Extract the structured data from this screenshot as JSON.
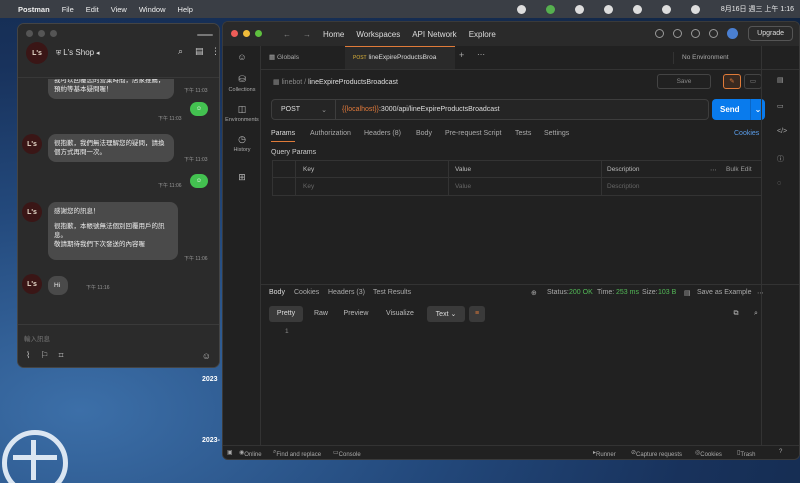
{
  "menubar": {
    "app": "Postman",
    "items": [
      "File",
      "Edit",
      "View",
      "Window",
      "Help"
    ],
    "datetime": "8月16日 週三 上午 1:16"
  },
  "desktop": {
    "stamp1": "2023",
    "stamp2": "2023-"
  },
  "line": {
    "avatar_text": "L's",
    "shop_name": "L's Shop",
    "input_placeholder": "輸入訊息",
    "messages": [
      {
        "text": "我可以回覆您的營業時間，店家推薦，預約等基本疑問喔！",
        "time": "下午 11:03"
      },
      {
        "mine": "☺",
        "time": "下午 11:03"
      },
      {
        "text": "很抱歉，我們無法理解您的疑問，請換個方式再問一次。",
        "time": "下午 11:03"
      },
      {
        "mine": "☺",
        "time": "下午 11:06"
      },
      {
        "text1": "感謝您的訊息！",
        "text2": "很抱歉，本帳號無法個別回覆用戶的訊息。",
        "text3": "敬請期待我們下次發送的內容喔",
        "time": "下午 11:06"
      },
      {
        "text": "Hi",
        "time": "下午 11:16"
      }
    ]
  },
  "postman": {
    "nav": [
      "Home",
      "Workspaces",
      "API Network",
      "Explore"
    ],
    "upgrade": "Upgrade",
    "sidebar": [
      "Collections",
      "Environments",
      "History"
    ],
    "tabs": {
      "globals": "Globals",
      "active_method": "POST",
      "active_name": "lineExpireProductsBroa"
    },
    "environment": "No Environment",
    "breadcrumb": {
      "parent": "linebot",
      "sep": "/",
      "name": "lineExpireProductsBroadcast"
    },
    "save_label": "Save",
    "request": {
      "method": "POST",
      "url_var": "{{localhost}}",
      "url_rest": ":3000/api/lineExpireProductsBroadcast",
      "send": "Send"
    },
    "req_tabs": [
      "Params",
      "Authorization",
      "Headers (8)",
      "Body",
      "Pre-request Script",
      "Tests",
      "Settings"
    ],
    "cookies": "Cookies",
    "query_params": "Query Params",
    "table": {
      "headers": [
        "Key",
        "Value",
        "Description"
      ],
      "bulk": "Bulk Edit",
      "placeholders": [
        "Key",
        "Value",
        "Description"
      ]
    },
    "response": {
      "tabs": [
        "Body",
        "Cookies",
        "Headers (3)",
        "Test Results"
      ],
      "status_label": "Status:",
      "status": "200 OK",
      "time_label": "Time:",
      "time": "253 ms",
      "size_label": "Size:",
      "size": "103 B",
      "save_example": "Save as Example",
      "views": [
        "Pretty",
        "Raw",
        "Preview",
        "Visualize"
      ],
      "format": "Text",
      "line_number": "1"
    },
    "statusbar": {
      "online": "Online",
      "find": "Find and replace",
      "console": "Console",
      "runner": "Runner",
      "capture": "Capture requests",
      "cookies": "Cookies",
      "trash": "Trash"
    }
  }
}
